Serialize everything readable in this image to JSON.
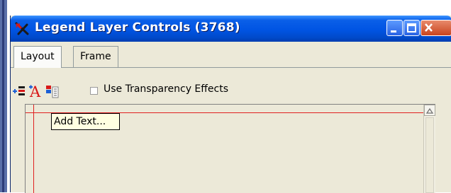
{
  "window": {
    "title": "Legend Layer Controls (3768)",
    "app_icon": "legend-tool-icon",
    "buttons": [
      "minimize",
      "maximize",
      "close"
    ]
  },
  "tabs": [
    {
      "label": "Layout",
      "active": true
    },
    {
      "label": "Frame",
      "active": false
    }
  ],
  "toolbar": {
    "icons": [
      "add-item-icon",
      "add-text-icon",
      "legend-style-icon"
    ],
    "transparency_checkbox": {
      "label": "Use Transparency Effects",
      "checked": false
    }
  },
  "tooltip": {
    "text": "Add Text..."
  },
  "colors": {
    "titlebar": "#0054e3",
    "close_button": "#c9441e",
    "guide_lines": "#e02020",
    "tooltip_bg": "#ffffe1",
    "window_bg": "#ece9d8"
  }
}
